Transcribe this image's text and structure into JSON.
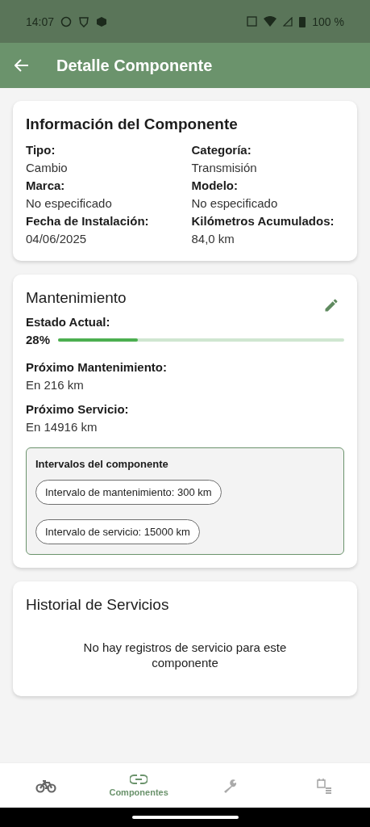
{
  "status_bar": {
    "time": "14:07",
    "battery": "100 %"
  },
  "app_bar": {
    "title": "Detalle Componente"
  },
  "info_card": {
    "title": "Información del Componente",
    "fields": [
      {
        "label": "Tipo:",
        "value": "Cambio"
      },
      {
        "label": "Categoría:",
        "value": "Transmisión"
      },
      {
        "label": "Marca:",
        "value": "No especificado"
      },
      {
        "label": "Modelo:",
        "value": "No especificado"
      },
      {
        "label": "Fecha de Instalación:",
        "value": "04/06/2025"
      },
      {
        "label": "Kilómetros Acumulados:",
        "value": "84,0 km"
      }
    ]
  },
  "maintenance_card": {
    "title": "Mantenimiento",
    "status_label": "Estado Actual:",
    "status_reading": "28%",
    "level": 0.28,
    "rows": [
      {
        "label": "Próximo Mantenimiento:",
        "value": "En 216 km"
      },
      {
        "label": "Próximo Servicio:",
        "value": "En 14916 km"
      }
    ],
    "intervals": {
      "title": "Intervalos del componente",
      "chips": [
        "Intervalo de mantenimiento: 300 km",
        "Intervalo de servicio: 15000 km"
      ]
    }
  },
  "history_card": {
    "title": "Historial de Servicios",
    "empty_message": "No hay registros de servicio para este componente"
  },
  "bottom_nav": [
    {
      "kind": "bike",
      "selected": false
    },
    {
      "kind": "link",
      "label": "Componentes",
      "selected": true
    },
    {
      "kind": "wrench",
      "selected": false
    },
    {
      "kind": "calendar",
      "selected": false
    }
  ]
}
